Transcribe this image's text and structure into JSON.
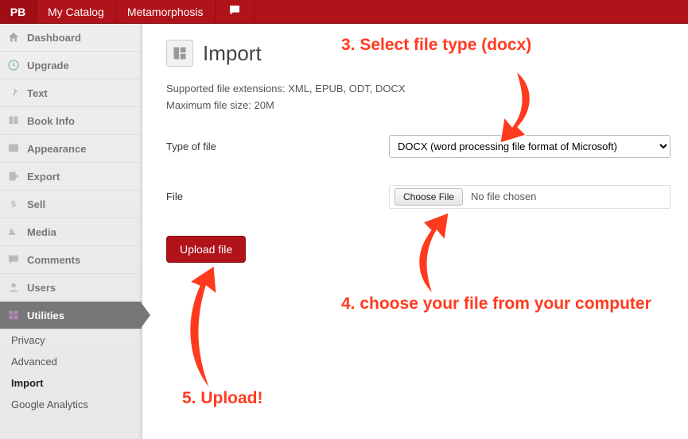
{
  "topbar": {
    "brand": "PB",
    "items": [
      "My Catalog",
      "Metamorphosis"
    ]
  },
  "sidebar": {
    "items": [
      {
        "label": "Dashboard",
        "icon": "home"
      },
      {
        "label": "Upgrade",
        "icon": "upgrade"
      },
      {
        "label": "Text",
        "icon": "pin"
      },
      {
        "label": "Book Info",
        "icon": "book"
      },
      {
        "label": "Appearance",
        "icon": "appearance"
      },
      {
        "label": "Export",
        "icon": "export"
      },
      {
        "label": "Sell",
        "icon": "dollar"
      },
      {
        "label": "Media",
        "icon": "media"
      },
      {
        "label": "Comments",
        "icon": "comment"
      },
      {
        "label": "Users",
        "icon": "user"
      },
      {
        "label": "Utilities",
        "icon": "utilities",
        "active": true
      }
    ],
    "subitems": [
      {
        "label": "Privacy"
      },
      {
        "label": "Advanced"
      },
      {
        "label": "Import",
        "bold": true
      },
      {
        "label": "Google Analytics"
      }
    ]
  },
  "page": {
    "title": "Import",
    "supported": "Supported file extensions: XML, EPUB, ODT, DOCX",
    "maxsize": "Maximum file size: 20M",
    "type_label": "Type of file",
    "type_value": "DOCX (word processing file format of Microsoft)",
    "file_label": "File",
    "choose_btn": "Choose File",
    "nofile": "No file chosen",
    "upload_btn": "Upload file"
  },
  "annotations": {
    "a3": "3. Select file type (docx)",
    "a4": "4. choose your file from your computer",
    "a5": "5. Upload!"
  }
}
